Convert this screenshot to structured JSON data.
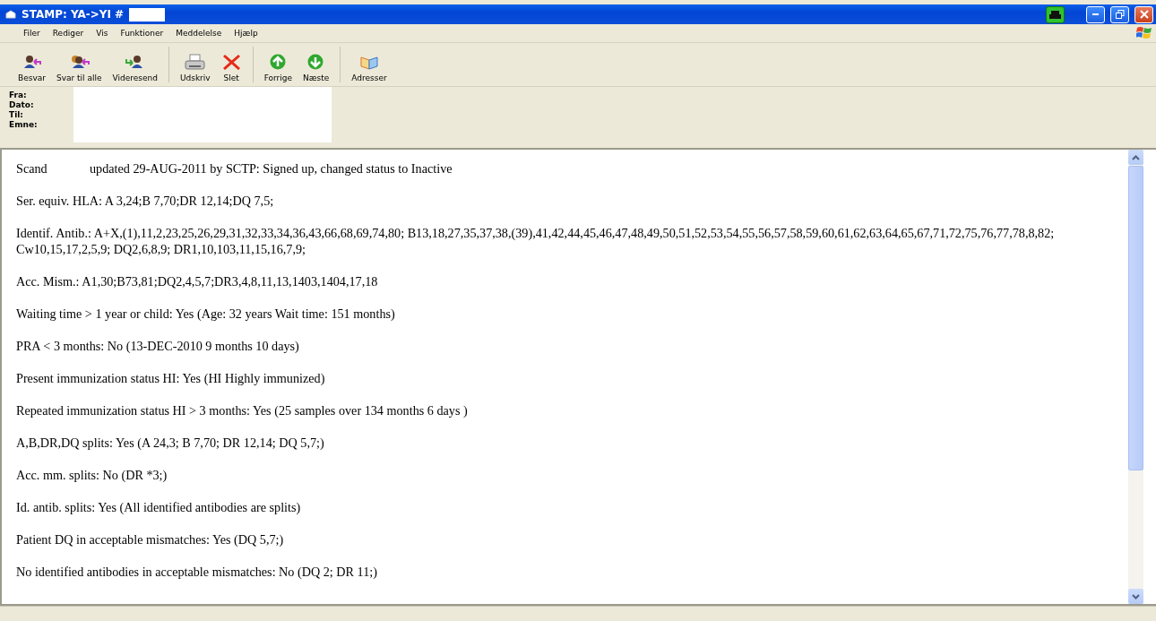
{
  "window": {
    "title": "STAMP: YA->YI #"
  },
  "menu": [
    "Filer",
    "Rediger",
    "Vis",
    "Funktioner",
    "Meddelelse",
    "Hjælp"
  ],
  "toolbar_groups": [
    [
      {
        "label": "Besvar",
        "kind": "reply"
      },
      {
        "label": "Svar til alle",
        "kind": "replyall"
      },
      {
        "label": "Videresend",
        "kind": "forward"
      }
    ],
    [
      {
        "label": "Udskriv",
        "kind": "print"
      },
      {
        "label": "Slet",
        "kind": "delete"
      }
    ],
    [
      {
        "label": "Forrige",
        "kind": "up"
      },
      {
        "label": "Næste",
        "kind": "down"
      }
    ],
    [
      {
        "label": "Adresser",
        "kind": "book"
      }
    ]
  ],
  "header_fields": [
    "Fra:",
    "Dato:",
    "Til:",
    "Emne:"
  ],
  "paragraphs": [
    {
      "lead": "Scand",
      "text": "updated 29-AUG-2011 by SCTP: Signed up, changed status to Inactive"
    },
    {
      "text": "Ser. equiv. HLA: A 3,24;B 7,70;DR 12,14;DQ 7,5;"
    },
    {
      "text": "Identif. Antib.: A+X,(1),11,2,23,25,26,29,31,32,33,34,36,43,66,68,69,74,80; B13,18,27,35,37,38,(39),41,42,44,45,46,47,48,49,50,51,52,53,54,55,56,57,58,59,60,61,62,63,64,65,67,71,72,75,76,77,78,8,82; Cw10,15,17,2,5,9; DQ2,6,8,9; DR1,10,103,11,15,16,7,9;"
    },
    {
      "text": "Acc. Mism.: A1,30;B73,81;DQ2,4,5,7;DR3,4,8,11,13,1403,1404,17,18"
    },
    {
      "text": "Waiting time > 1 year or child: Yes (Age: 32 years Wait time: 151 months)"
    },
    {
      "text": "PRA < 3 months: No (13-DEC-2010 9 months 10 days)"
    },
    {
      "text": "Present immunization status HI: Yes (HI Highly immunized)"
    },
    {
      "text": "Repeated immunization status HI > 3 months: Yes (25 samples over 134 months 6 days )"
    },
    {
      "text": "A,B,DR,DQ splits: Yes (A 24,3; B 7,70; DR 12,14; DQ 5,7;)"
    },
    {
      "text": "Acc. mm. splits: No (DR *3;)"
    },
    {
      "text": "Id. antib. splits: Yes (All identified antibodies are splits)"
    },
    {
      "text": "Patient DQ in acceptable mismatches: Yes (DQ 5,7;)"
    },
    {
      "text": "No identified antibodies in acceptable mismatches: No (DQ 2; DR 11;)"
    }
  ]
}
